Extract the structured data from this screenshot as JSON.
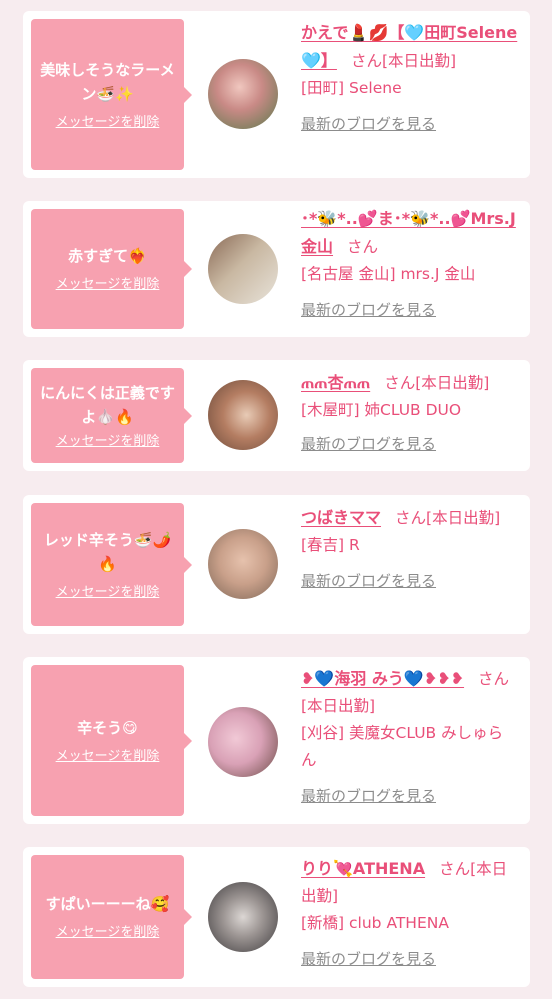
{
  "cards": [
    {
      "message": "美味しそうなラーメン🍜✨",
      "delete_label": "メッセージを削除",
      "name": "かえで💄💋【🩵田町Selene🩵】",
      "honorific": "さん",
      "status": "[本日出勤]",
      "shop": "[田町] Selene",
      "blog_link": "最新のブログを見る",
      "avatar_colors": [
        "#c98a86",
        "#5a7a4b"
      ]
    },
    {
      "message": "赤すぎて❤️‍🔥",
      "delete_label": "メッセージを削除",
      "name": "･*🐝*..💕ま･*🐝*..💕Mrs.J金山",
      "honorific": "さん",
      "status": "",
      "shop": "[名古屋 金山] mrs.J 金山",
      "blog_link": "最新のブログを見る",
      "avatar_colors": [
        "#8a6a56",
        "#e8e3da"
      ]
    },
    {
      "message": "にんにくは正義ですよ🧄🔥",
      "delete_label": "メッセージを削除",
      "name": "ጠጠ杏ጠጠ",
      "honorific": "さん",
      "status": "[本日出勤]",
      "shop": "[木屋町] 姉CLUB DUO",
      "blog_link": "最新のブログを見る",
      "avatar_colors": [
        "#6b4a3a",
        "#e8cbb6"
      ]
    },
    {
      "message": "レッド辛そう🍜🌶️🔥",
      "delete_label": "メッセージを削除",
      "name": "つばきママ",
      "honorific": "さん",
      "status": "[本日出勤]",
      "shop": "[春吉] R",
      "blog_link": "最新のブログを見る",
      "avatar_colors": [
        "#b08a74",
        "#e6c2ad"
      ]
    },
    {
      "message": "辛そう😋",
      "delete_label": "メッセージを削除",
      "name": "❥💙海羽 みう💙❥❥❥",
      "honorific": "さん",
      "status": "[本日出勤]",
      "shop": "[刈谷] 美魔女CLUB みしゅらん",
      "blog_link": "最新のブログを見る",
      "avatar_colors": [
        "#d9a1b6",
        "#6a4a44"
      ]
    },
    {
      "message": "すぱいーーーね🥰",
      "delete_label": "メッセージを削除",
      "name": "りり💘ATHENA",
      "honorific": "さん",
      "status": "[本日出勤]",
      "shop": "[新橋] club ATHENA",
      "blog_link": "最新のブログを見る",
      "avatar_colors": [
        "#3d3a3c",
        "#dcd7d4"
      ]
    }
  ]
}
